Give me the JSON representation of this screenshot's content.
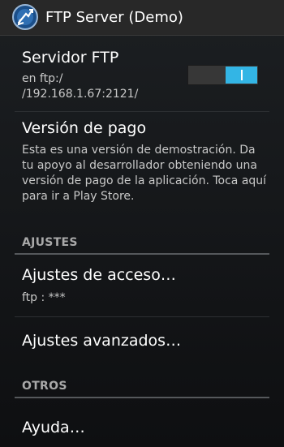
{
  "app": {
    "title": "FTP Server (Demo)",
    "icon": "ftp-server-app-icon"
  },
  "server_pref": {
    "title": "Servidor FTP",
    "summary_line1": "en ftp:/",
    "summary_line2": "/192.168.1.67:2121/",
    "toggle_on": true
  },
  "paid_pref": {
    "title": "Versión de pago",
    "summary": "Esta es una versión de demostración. Da tu apoyo al desarrollador obteniendo una versión de pago de la aplicación. Toca aquí para ir a Play Store."
  },
  "settings_category": {
    "title": "AJUSTES",
    "access": {
      "title": "Ajustes de acceso…",
      "summary": "ftp : ***"
    },
    "advanced": {
      "title": "Ajustes avanzados…"
    }
  },
  "others_category": {
    "title": "OTROS",
    "help": {
      "title": "Ayuda…"
    }
  },
  "colors": {
    "accent": "#33b5e5",
    "action_bar": "#282828",
    "category_text": "#a9a9a9"
  }
}
